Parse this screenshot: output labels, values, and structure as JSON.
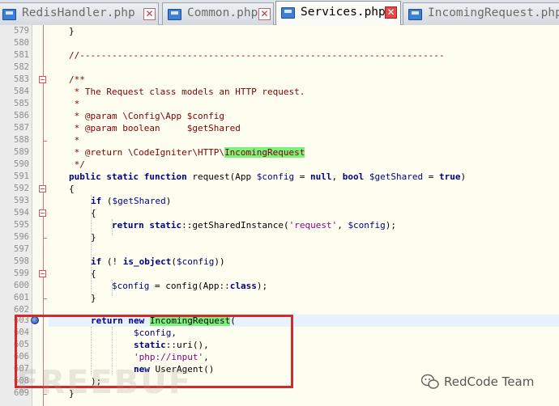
{
  "tabs": [
    {
      "label": "RedisHandler.php",
      "active": false
    },
    {
      "label": "Common.php",
      "active": false
    },
    {
      "label": "Services.php",
      "active": true
    },
    {
      "label": "IncomingRequest.php",
      "active": false
    }
  ],
  "line_numbers": [
    "579",
    "580",
    "581",
    "582",
    "583",
    "584",
    "585",
    "586",
    "587",
    "588",
    "589",
    "590",
    "591",
    "592",
    "593",
    "594",
    "595",
    "596",
    "597",
    "598",
    "599",
    "600",
    "601",
    "602",
    "603",
    "604",
    "605",
    "606",
    "607",
    "608",
    "609"
  ],
  "code": {
    "l579": "}",
    "l581": "//--------------------------------------------------------------------",
    "l583": "/**",
    "l584": " * The Request class models an HTTP request.",
    "l585": " *",
    "l586": " * @param \\Config\\App $config",
    "l587": " * @param boolean     $getShared",
    "l588": " *",
    "l589_a": " * @return \\CodeIgniter\\HTTP\\",
    "l589_b": "IncomingRequest",
    "l590": " */",
    "l591_kw1": "public static function",
    "l591_b": " request(App ",
    "l591_v1": "$config",
    "l591_c": " = ",
    "l591_kw2": "null",
    "l591_d": ", ",
    "l591_kw3": "bool",
    "l591_e": " ",
    "l591_v2": "$getShared",
    "l591_f": " = ",
    "l591_kw4": "true",
    "l591_g": ")",
    "l592": "{",
    "l593_kw": "if",
    "l593_a": " (",
    "l593_v": "$getShared",
    "l593_b": ")",
    "l594": "{",
    "l595_kw1": "return",
    "l595_a": " ",
    "l595_kw2": "static",
    "l595_b": "::getSharedInstance(",
    "l595_st": "'request'",
    "l595_c": ", ",
    "l595_v": "$config",
    "l595_d": ");",
    "l596": "}",
    "l598_kw1": "if",
    "l598_a": " (! ",
    "l598_kw2": "is_object",
    "l598_b": "(",
    "l598_v": "$config",
    "l598_c": "))",
    "l599": "{",
    "l600_v": "$config",
    "l600_a": " = config(App::",
    "l600_kw": "class",
    "l600_b": ");",
    "l601": "}",
    "l603_kw1": "return",
    "l603_a": " ",
    "l603_kw2": "new",
    "l603_b": " ",
    "l603_hl": "IncomingRequest",
    "l603_c": "(",
    "l604": "$config,",
    "l605_kw": "static",
    "l605_a": "::uri(),",
    "l606_st": "'php://input'",
    "l606_a": ",",
    "l607_kw": "new",
    "l607_a": " UserAgent()",
    "l608": ");",
    "l609": "}"
  },
  "watermark": "FREEBUF",
  "brand": "RedCode Team"
}
